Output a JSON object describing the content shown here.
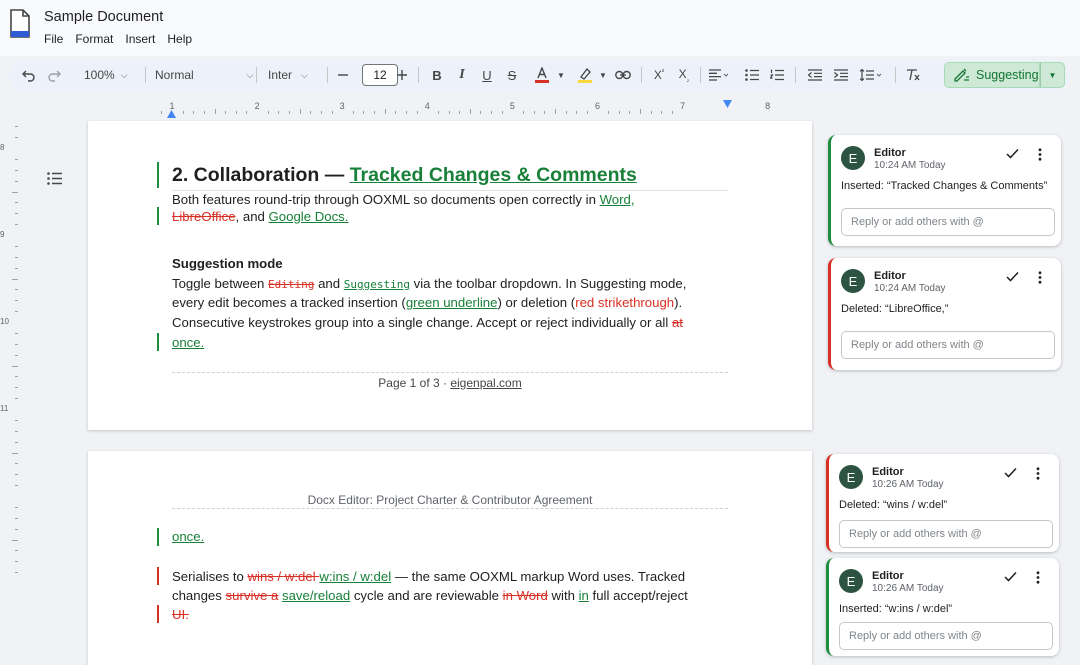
{
  "header": {
    "doc_title": "Sample Document",
    "menu": [
      "File",
      "Format",
      "Insert",
      "Help"
    ]
  },
  "toolbar": {
    "zoom": "100%",
    "style": "Normal",
    "font": "Inter",
    "font_size": "12",
    "mode_label": "Suggesting",
    "accent_color": "#137333"
  },
  "ruler": {
    "numbers": [
      "1",
      "2",
      "3",
      "4",
      "5",
      "6",
      "7",
      "8"
    ],
    "vertical_numbers": [
      "8",
      "9",
      "10",
      "11"
    ]
  },
  "page1": {
    "heading_prefix": "2.  Collaboration — ",
    "heading_ins": "Tracked Changes & Comments",
    "p1": {
      "l1_a": "Both features round-trip through OOXML so documents open correctly in ",
      "l1_ins": "Word,",
      "l2_del": "LibreOffice",
      "l2_a": ", and ",
      "l2_ins": "Google Docs."
    },
    "subheading": "Suggestion mode",
    "p2": {
      "l1_a": "Toggle between ",
      "l1_del": "Editing",
      "l1_b": " and ",
      "l1_ins": "Suggesting",
      "l1_c": " via the toolbar dropdown. In Suggesting mode,",
      "l2_a": "every edit becomes a tracked insertion (",
      "l2_ins": "green underline",
      "l2_b": ") or deletion (",
      "l2_del": "red strikethrough",
      "l2_c": ").",
      "l3_a": "Consecutive keystrokes group into a single change. Accept or reject individually or all ",
      "l3_del": "at",
      "l4_ins": "once."
    },
    "footer_prefix": "Page 1 of 3 · ",
    "footer_link": "eigenpal.com"
  },
  "page2": {
    "header_text": "Docx Editor: Project Charter & Contributor Agreement",
    "p1_ins": "once.",
    "p2": {
      "l1_a": "Serialises to ",
      "l1_del": " wins / w:del ",
      "l1_b": " ",
      "l1_ins": "w:ins / w:del",
      "l1_c": " — the same OOXML markup Word uses. Tracked",
      "l2_a": "changes ",
      "l2_del": "survive a",
      "l2_b": " ",
      "l2_ins": "save/reload",
      "l2_c": " cycle and are reviewable ",
      "l2_del2": "in Word",
      "l2_d": " with ",
      "l2_ins2": "in",
      "l2_e": " full accept/reject",
      "l3_del": "UI."
    }
  },
  "comments": [
    {
      "avatar": "E",
      "author": "Editor",
      "time": "10:24 AM Today",
      "label": "Inserted: ",
      "text": "“Tracked Changes & Comments”",
      "reply_placeholder": "Reply or add others with @",
      "kind": "insert"
    },
    {
      "avatar": "E",
      "author": "Editor",
      "time": "10:24 AM Today",
      "label": "Deleted: ",
      "text": "“LibreOffice,”",
      "reply_placeholder": "Reply or add others with @",
      "kind": "delete"
    },
    {
      "avatar": "E",
      "author": "Editor",
      "time": "10:26 AM Today",
      "label": "Deleted: ",
      "text": "“wins / w:del”",
      "reply_placeholder": "Reply or add others with @",
      "kind": "delete"
    },
    {
      "avatar": "E",
      "author": "Editor",
      "time": "10:26 AM Today",
      "label": "Inserted: ",
      "text": "“w:ins / w:del”",
      "reply_placeholder": "Reply or add others with @",
      "kind": "insert"
    }
  ]
}
